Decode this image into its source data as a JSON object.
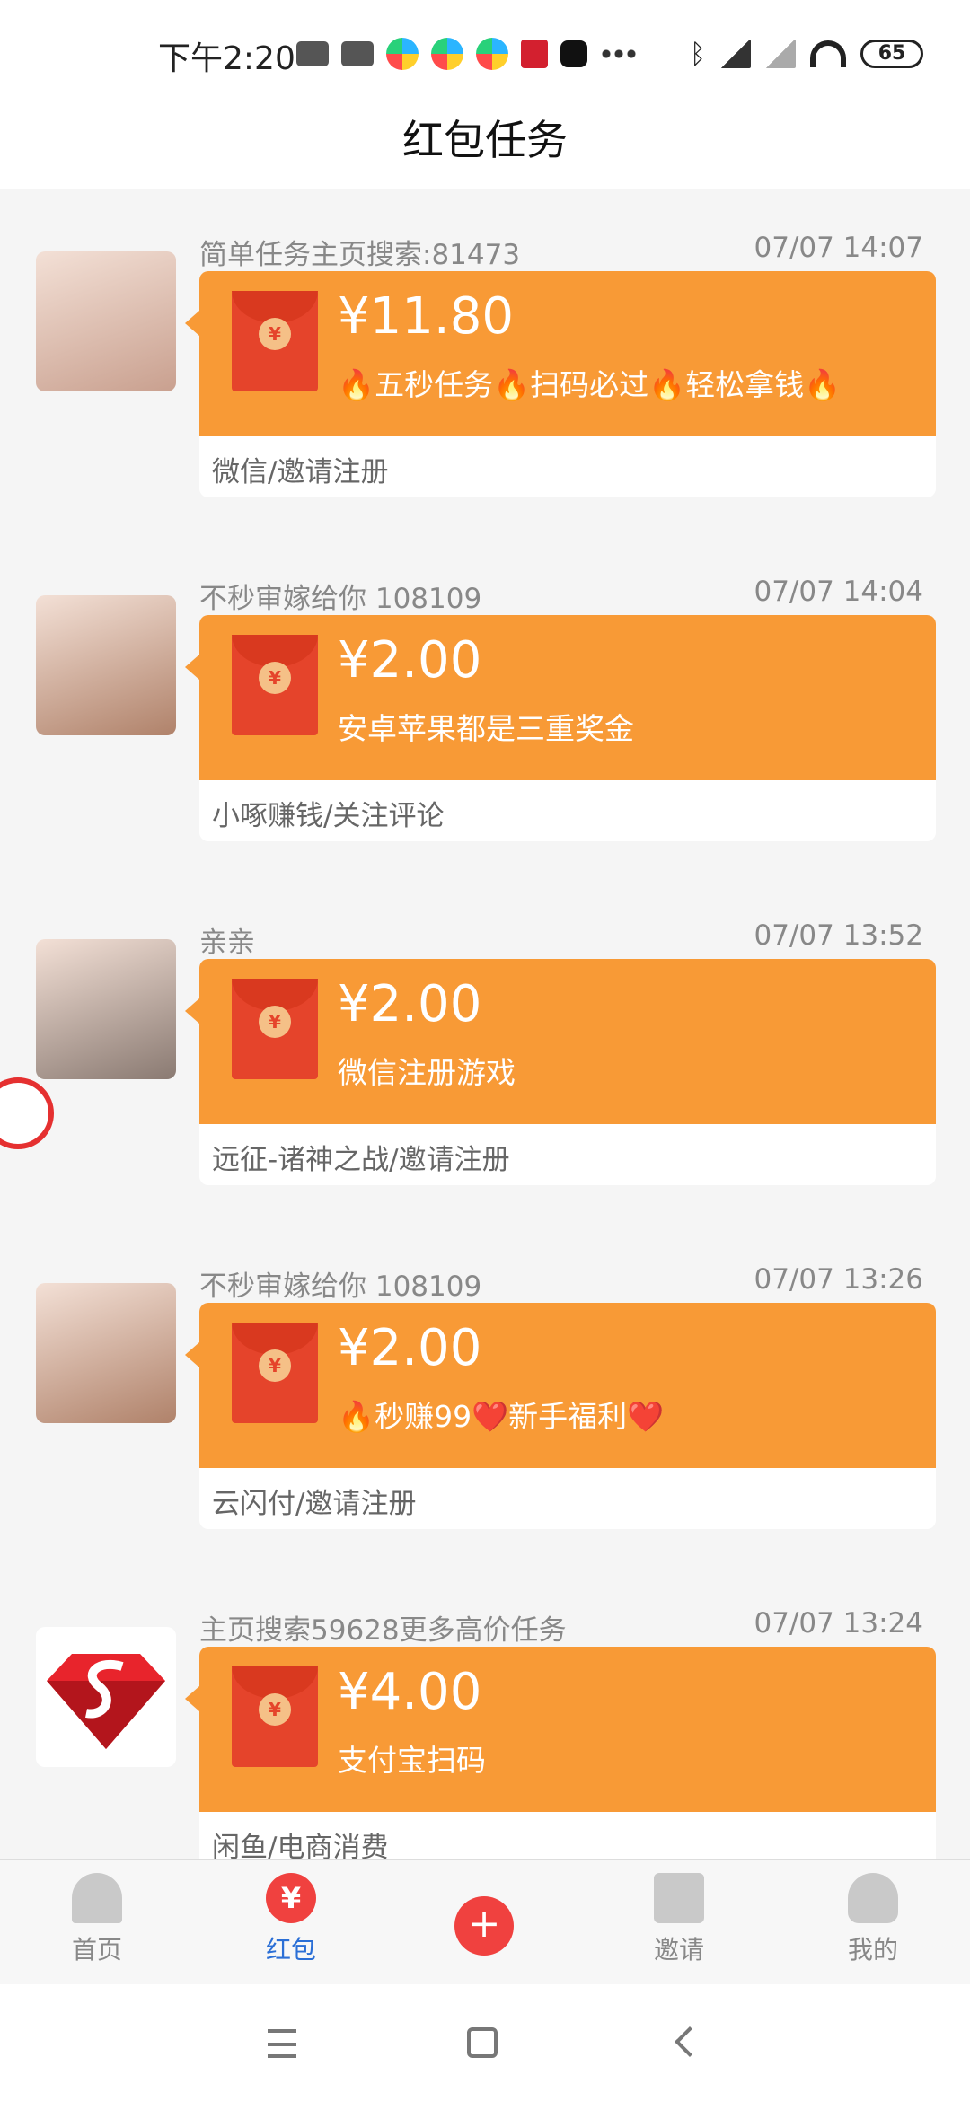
{
  "status_bar": {
    "time": "下午2:20",
    "battery": "65",
    "icons": [
      "message-icon",
      "message-icon",
      "app-icon",
      "app-icon",
      "app-icon",
      "app-icon",
      "tiktok-icon",
      "more-dots-icon",
      "bluetooth-icon",
      "signal-hd-icon",
      "signal-icon",
      "wifi-icon",
      "battery-icon"
    ]
  },
  "header": {
    "title": "红包任务"
  },
  "tasks": [
    {
      "name": "简单任务主页搜索:81473",
      "time": "07/07 14:07",
      "amount": "¥11.80",
      "desc": "🔥五秒任务🔥扫码必过🔥轻松拿钱🔥",
      "category": "微信/邀请注册",
      "avatar_color": "#c9a08f"
    },
    {
      "name": "不秒审嫁给你 108109",
      "time": "07/07 14:04",
      "amount": "¥2.00",
      "desc": "安卓苹果都是三重奖金",
      "category": "小啄赚钱/关注评论",
      "avatar_color": "#b0826a"
    },
    {
      "name": "亲亲",
      "time": "07/07 13:52",
      "amount": "¥2.00",
      "desc": "微信注册游戏",
      "category": "远征-诸神之战/邀请注册",
      "avatar_color": "#8a7a72"
    },
    {
      "name": "不秒审嫁给你 108109",
      "time": "07/07 13:26",
      "amount": "¥2.00",
      "desc": "🔥秒赚99❤️新手福利❤️",
      "category": "云闪付/邀请注册",
      "avatar_color": "#b0826a"
    },
    {
      "name": "主页搜索59628更多高价任务",
      "time": "07/07 13:24",
      "amount": "¥4.00",
      "desc": "支付宝扫码",
      "category": "闲鱼/电商消费",
      "avatar_color": "#e8242c"
    }
  ],
  "bottom_nav": {
    "home": "首页",
    "redpacket": "红包",
    "redpacket_glyph": "¥",
    "plus": "+",
    "invite": "邀请",
    "mine": "我的"
  },
  "colors": {
    "accent": "#f89a36",
    "envelope": "#e5442b",
    "active_tab": "#2b6fd6"
  }
}
